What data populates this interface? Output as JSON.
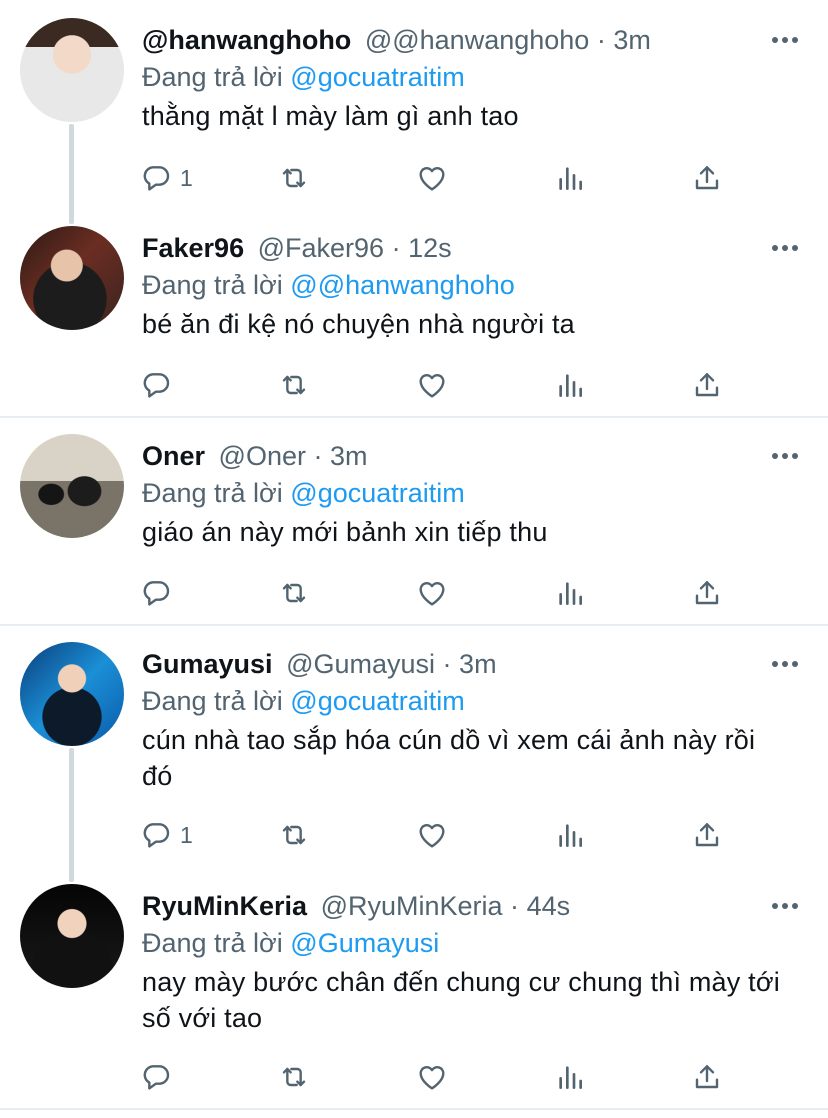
{
  "replying_prefix": "Đang trả lời",
  "tweets": [
    {
      "name": "@hanwanghoho",
      "handle": "@@hanwanghoho",
      "dot": "·",
      "time": "3m",
      "reply_to": "@gocuatraitim",
      "text": "thằng mặt l mày làm gì anh tao",
      "reply_count": "1"
    },
    {
      "name": "Faker96",
      "handle": "@Faker96",
      "dot": "·",
      "time": "12s",
      "reply_to": "@@hanwanghoho",
      "text": "bé ăn đi kệ nó chuyện nhà người ta",
      "reply_count": ""
    },
    {
      "name": "Oner",
      "handle": "@Oner",
      "dot": "·",
      "time": "3m",
      "reply_to": "@gocuatraitim",
      "text": "giáo án này mới bảnh xin tiếp thu",
      "reply_count": ""
    },
    {
      "name": "Gumayusi",
      "handle": "@Gumayusi",
      "dot": "·",
      "time": "3m",
      "reply_to": "@gocuatraitim",
      "text": "cún nhà tao sắp hóa cún dồ vì xem cái ảnh này rồi đó",
      "reply_count": "1"
    },
    {
      "name": "RyuMinKeria",
      "handle": "@RyuMinKeria",
      "dot": "·",
      "time": "44s",
      "reply_to": "@Gumayusi",
      "text": "nay mày bước chân đến chung cư chung thì mày tới số với tao",
      "reply_count": ""
    }
  ],
  "icons": {
    "reply": "reply-icon",
    "retweet": "retweet-icon",
    "like": "heart-icon",
    "analytics": "analytics-icon",
    "share": "share-icon",
    "more": "more-icon"
  },
  "colors": {
    "text": "#0f1419",
    "secondary": "#536471",
    "link": "#1d9bf0",
    "thread_line": "#cfd9de",
    "divider": "#e7ecf0"
  }
}
